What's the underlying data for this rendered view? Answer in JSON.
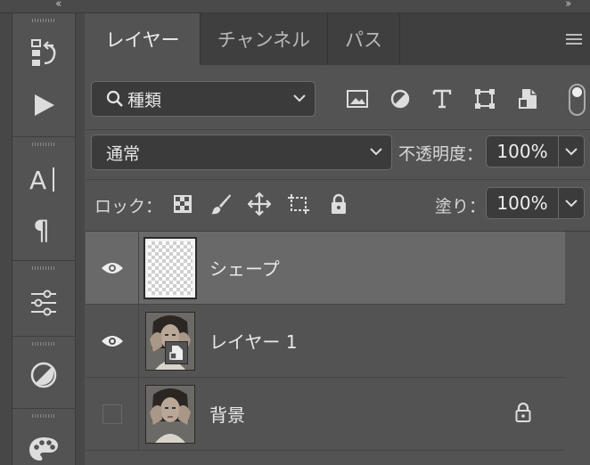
{
  "tabs": [
    {
      "label": "レイヤー",
      "active": true
    },
    {
      "label": "チャンネル",
      "active": false
    },
    {
      "label": "パス",
      "active": false
    }
  ],
  "filter": {
    "kind_label": "種類"
  },
  "blend": {
    "mode": "通常",
    "opacity_label": "不透明度：",
    "opacity_value": "100%"
  },
  "lock": {
    "label": "ロック：",
    "fill_label": "塗り：",
    "fill_value": "100%"
  },
  "layers": [
    {
      "name": "シェープ",
      "visible": true,
      "selected": true,
      "type": "shape"
    },
    {
      "name": "レイヤー 1",
      "visible": true,
      "selected": false,
      "type": "smart-object"
    },
    {
      "name": "背景",
      "visible": false,
      "selected": false,
      "type": "background",
      "locked": true
    }
  ],
  "tools": [
    "history-icon",
    "play-icon",
    "character-icon",
    "paragraph-icon",
    "adjustments-icon",
    "contrast-icon",
    "palette-icon"
  ]
}
